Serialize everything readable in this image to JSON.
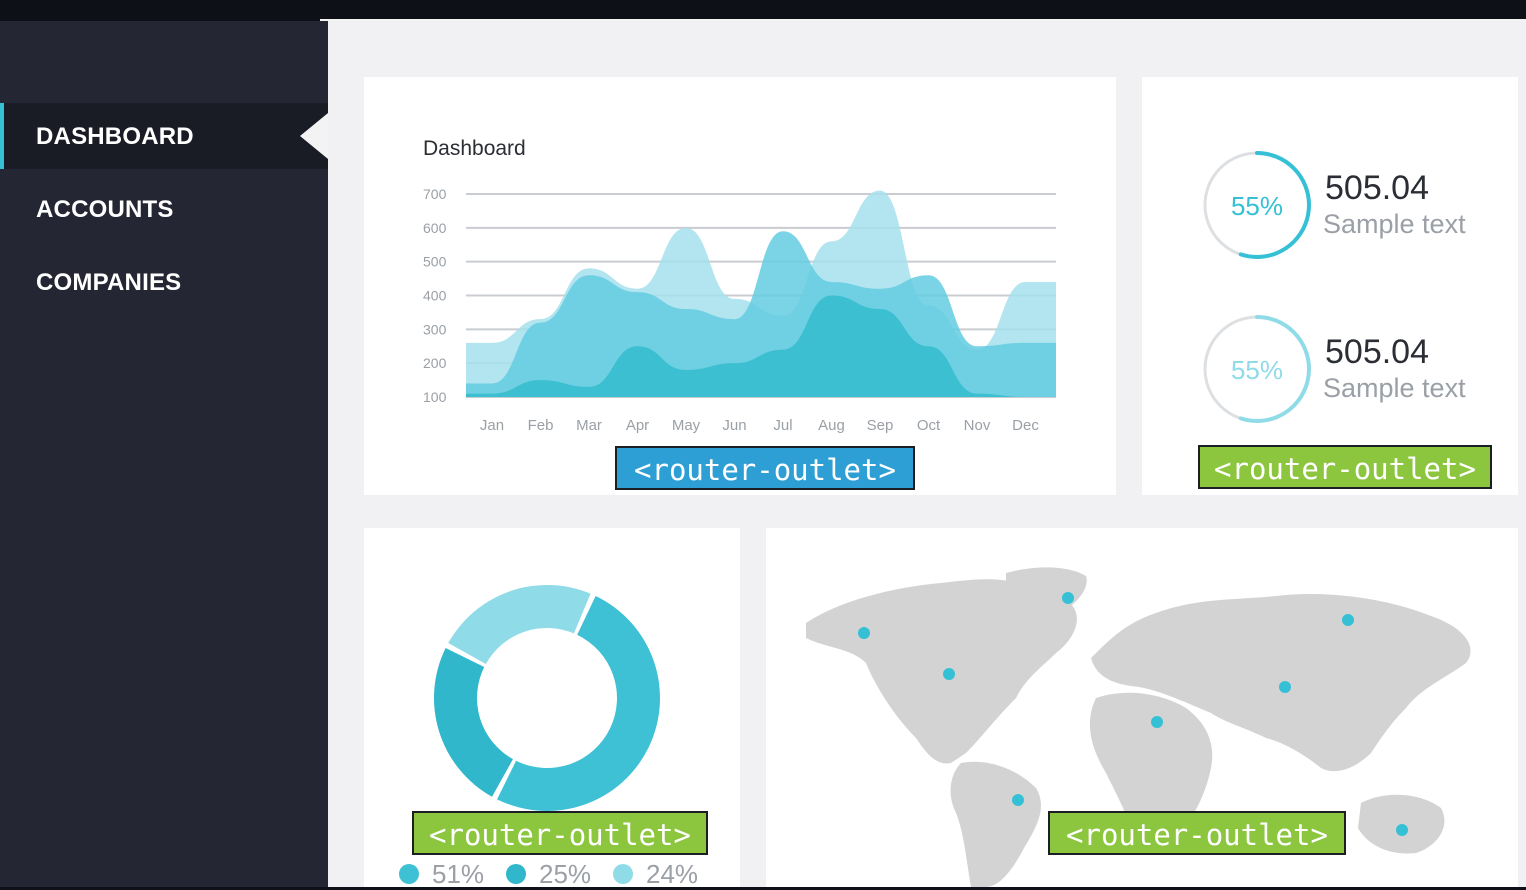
{
  "sidebar": {
    "items": [
      {
        "label": "DASHBOARD",
        "active": true
      },
      {
        "label": "ACCOUNTS",
        "active": false
      },
      {
        "label": "COMPANIES",
        "active": false
      }
    ]
  },
  "chart_card": {
    "title": "Dashboard",
    "outlet_label": "<router-outlet>"
  },
  "chart_data": {
    "type": "area",
    "title": "Dashboard",
    "categories": [
      "Jan",
      "Feb",
      "Mar",
      "Apr",
      "May",
      "Jun",
      "Jul",
      "Aug",
      "Sep",
      "Oct",
      "Nov",
      "Dec"
    ],
    "y_ticks": [
      700,
      600,
      500,
      400,
      300,
      200,
      100
    ],
    "ylim": [
      100,
      700
    ],
    "grid": true,
    "series": [
      {
        "values": [
          260,
          330,
          480,
          420,
          600,
          390,
          340,
          560,
          710,
          370,
          240,
          440
        ],
        "color": "#a5e1ec"
      },
      {
        "values": [
          140,
          320,
          460,
          410,
          360,
          330,
          590,
          440,
          420,
          460,
          250,
          260
        ],
        "color": "#63cde0"
      },
      {
        "values": [
          110,
          150,
          130,
          250,
          180,
          200,
          240,
          400,
          360,
          250,
          110,
          100
        ],
        "color": "#35bccf"
      }
    ]
  },
  "stats_card": {
    "stats": [
      {
        "percent": "55%",
        "value": "505.04",
        "text": "Sample text",
        "progress": 0.55
      },
      {
        "percent": "55%",
        "value": "505.04",
        "text": "Sample text",
        "progress": 0.55
      }
    ],
    "outlet_label": "<router-outlet>"
  },
  "donut_card": {
    "segments": [
      {
        "percent": 0.51,
        "label": "51%",
        "color": "#3ec0d5"
      },
      {
        "percent": 0.25,
        "label": "25%",
        "color": "#30b7cc"
      },
      {
        "percent": 0.24,
        "label": "24%",
        "color": "#8fdbe8"
      }
    ],
    "outlet_label": "<router-outlet>"
  },
  "map_card": {
    "outlet_label": "<router-outlet>"
  },
  "colors": {
    "accent": "#35c0d6",
    "outlet_blue": "#2e9fd4",
    "outlet_green": "#8cc63f",
    "sidebar": "#242633"
  }
}
